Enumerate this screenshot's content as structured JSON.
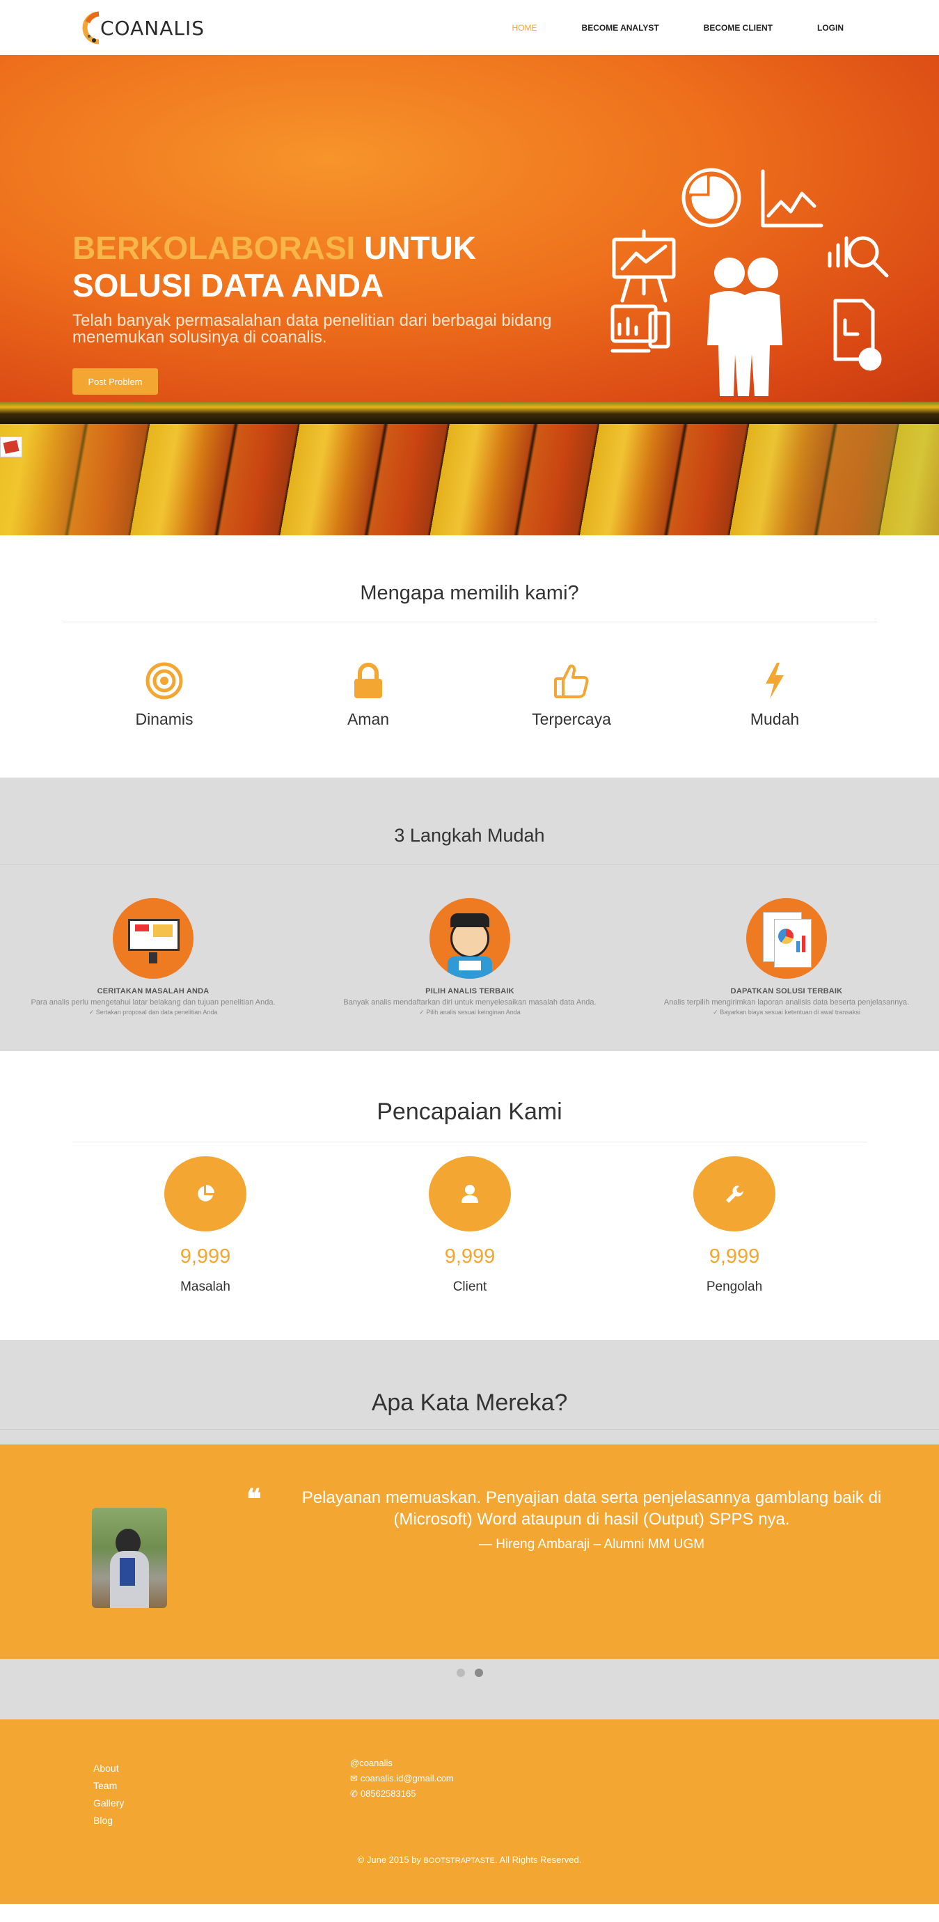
{
  "brand": {
    "name": "COANALIS"
  },
  "nav": {
    "items": [
      "HOME",
      "BECOME ANALYST",
      "BECOME CLIENT",
      "LOGIN"
    ],
    "active": "HOME"
  },
  "hero": {
    "title_highlight": "BERKOLABORASI",
    "title_rest_1": " UNTUK",
    "title_line_2": "SOLUSI DATA ANDA",
    "subtitle": "Telah banyak permasalahan data penelitian dari berbagai bidang menemukan solusinya di coanalis.",
    "button": "Post Problem"
  },
  "why": {
    "title": "Mengapa memilih kami?",
    "features": [
      {
        "label": "Dinamis",
        "icon": "target-icon"
      },
      {
        "label": "Aman",
        "icon": "lock-icon"
      },
      {
        "label": "Terpercaya",
        "icon": "thumbs-up-icon"
      },
      {
        "label": "Mudah",
        "icon": "lightning-icon"
      }
    ]
  },
  "steps": {
    "title": "3 Langkah Mudah",
    "items": [
      {
        "title": "CERITAKAN MASALAH ANDA",
        "desc": "Para analis perlu mengetahui latar belakang dan tujuan penelitian Anda.",
        "note": "✓ Sertakan proposal dan data penelitian Anda"
      },
      {
        "title": "PILIH ANALIS TERBAIK",
        "desc": "Banyak analis mendaftarkan diri untuk menyelesaikan masalah data Anda.",
        "note": "✓ Pilih analis sesuai keinginan Anda"
      },
      {
        "title": "DAPATKAN SOLUSI TERBAIK",
        "desc": "Analis terpilih mengirimkan laporan analisis data beserta penjelasannya.",
        "note": "✓ Bayarkan biaya sesuai ketentuan di awal transaksi"
      }
    ]
  },
  "achievements": {
    "title": "Pencapaian Kami",
    "items": [
      {
        "value": "9,999",
        "label": "Masalah",
        "icon": "pie-chart-icon"
      },
      {
        "value": "9,999",
        "label": "Client",
        "icon": "user-icon"
      },
      {
        "value": "9,999",
        "label": "Pengolah",
        "icon": "wrench-icon"
      }
    ]
  },
  "testimonials": {
    "title": "Apa Kata Mereka?",
    "quote_line_1": "Pelayanan memuaskan. Penyajian data serta penjelasannya gamblang baik di",
    "quote_line_2": "(Microsoft) Word ataupun di hasil (Output) SPPS nya.",
    "author": "— Hireng Ambaraji – Alumni MM UGM",
    "active_slide": 2,
    "slide_count": 2
  },
  "footer": {
    "links": [
      "About",
      "Team",
      "Gallery",
      "Blog"
    ],
    "social": "@coanalis",
    "email": "coanalis.id@gmail.com",
    "phone": "08562583165",
    "copyright_pre": "© June 2015 by ",
    "copyright_brand": "BOOTSTRAPTASTE",
    "copyright_post": ". All Rights Reserved."
  },
  "colors": {
    "accent": "#f4a632",
    "section_gray": "#dcdcdc",
    "hero_orange": "#ee6f1c"
  }
}
